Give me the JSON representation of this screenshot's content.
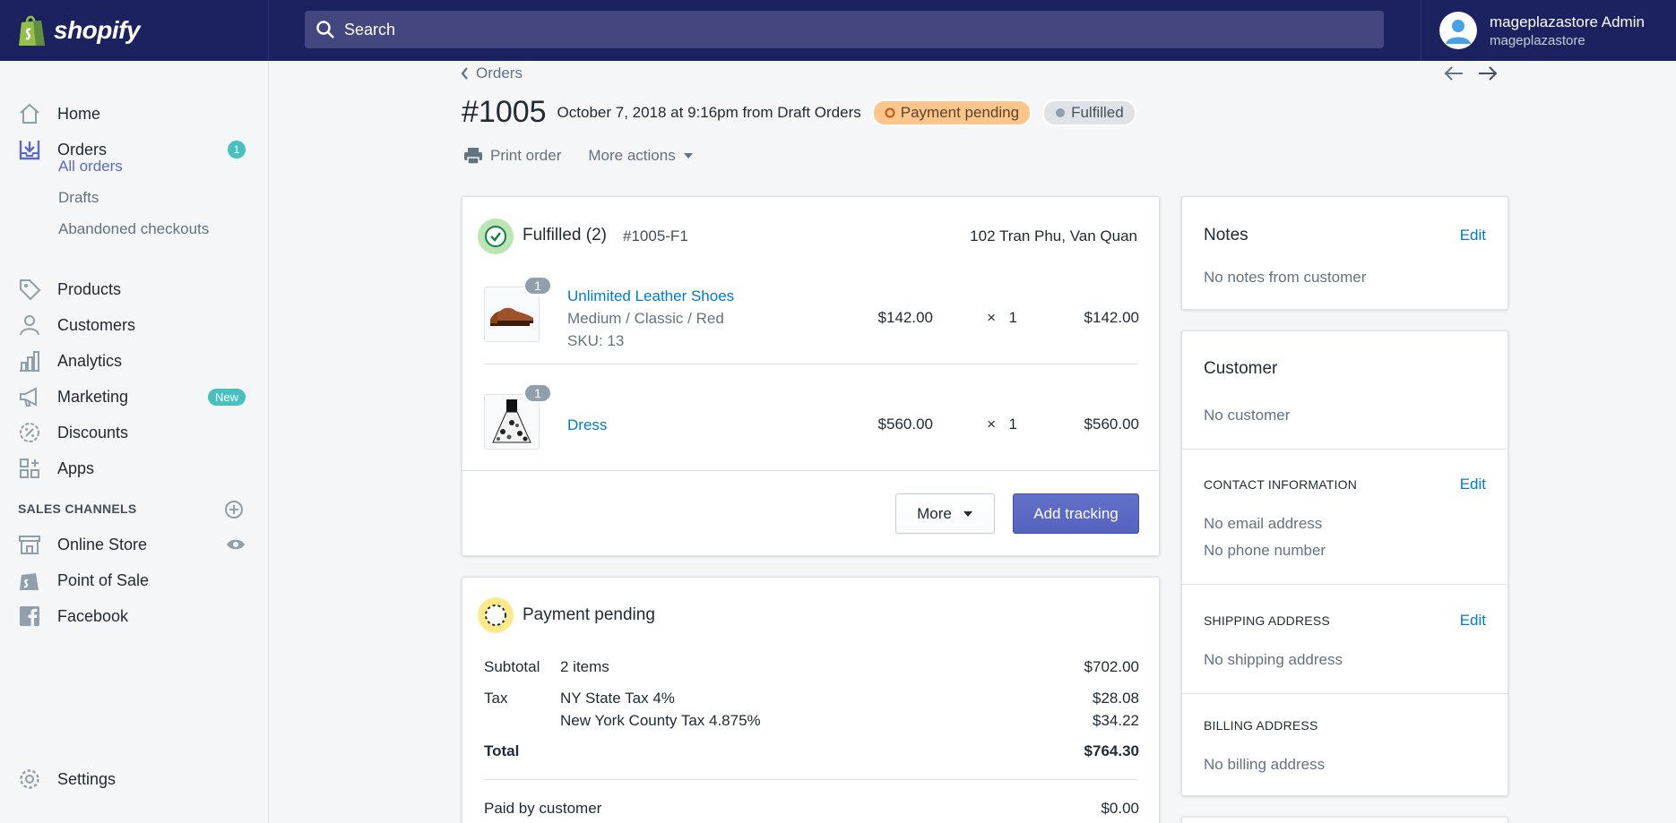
{
  "brand": {
    "name": "shopify"
  },
  "search": {
    "placeholder": "Search"
  },
  "user": {
    "name": "mageplazastore Admin",
    "store": "mageplazastore"
  },
  "sidebar": {
    "items": [
      {
        "label": "Home",
        "icon": "home-icon"
      },
      {
        "label": "Orders",
        "icon": "orders-icon",
        "badge": "1"
      },
      {
        "label": "Products",
        "icon": "tag-icon"
      },
      {
        "label": "Customers",
        "icon": "person-icon"
      },
      {
        "label": "Analytics",
        "icon": "bar-chart-icon"
      },
      {
        "label": "Marketing",
        "icon": "megaphone-icon",
        "badge": "New"
      },
      {
        "label": "Discounts",
        "icon": "discount-icon"
      },
      {
        "label": "Apps",
        "icon": "apps-icon"
      }
    ],
    "order_sub": [
      "All orders",
      "Drafts",
      "Abandoned checkouts"
    ],
    "sales_channels_title": "SALES CHANNELS",
    "channels": [
      {
        "label": "Online Store",
        "icon": "store-icon"
      },
      {
        "label": "Point of Sale",
        "icon": "shopify-bag-icon"
      },
      {
        "label": "Facebook",
        "icon": "facebook-icon"
      }
    ],
    "settings": "Settings"
  },
  "order": {
    "back_label": "Orders",
    "number": "#1005",
    "meta": "October 7, 2018 at 9:16pm from Draft Orders",
    "payment_status": "Payment pending",
    "fulfillment_status": "Fulfilled",
    "print": "Print order",
    "more_actions": "More actions"
  },
  "fulfillment": {
    "title": "Fulfilled (2)",
    "id": "#1005-F1",
    "location": "102 Tran Phu, Van Quan",
    "items": [
      {
        "name": "Unlimited Leather Shoes",
        "variant": "Medium / Classic / Red",
        "sku": "SKU: 13",
        "qty_badge": "1",
        "price": "$142.00",
        "times": "×",
        "qty": "1",
        "total": "$142.00"
      },
      {
        "name": "Dress",
        "variant": "",
        "sku": "",
        "qty_badge": "1",
        "price": "$560.00",
        "times": "×",
        "qty": "1",
        "total": "$560.00"
      }
    ],
    "more_label": "More",
    "add_tracking_label": "Add tracking"
  },
  "payment": {
    "title": "Payment pending",
    "subtotal_label": "Subtotal",
    "subtotal_desc": "2 items",
    "subtotal": "$702.00",
    "tax_label": "Tax",
    "tax_lines": [
      {
        "desc": "NY State Tax 4%",
        "amount": "$28.08"
      },
      {
        "desc": "New York County Tax 4.875%",
        "amount": "$34.22"
      }
    ],
    "total_label": "Total",
    "total": "$764.30",
    "paid_label": "Paid by customer",
    "paid": "$0.00"
  },
  "notes": {
    "title": "Notes",
    "edit": "Edit",
    "text": "No notes from customer"
  },
  "customer": {
    "title": "Customer",
    "text": "No customer",
    "contact_title": "CONTACT INFORMATION",
    "contact_edit": "Edit",
    "email": "No email address",
    "phone": "No phone number",
    "shipping_title": "SHIPPING ADDRESS",
    "shipping_edit": "Edit",
    "shipping": "No shipping address",
    "billing_title": "BILLING ADDRESS",
    "billing": "No billing address"
  },
  "colors": {
    "topbar": "#1c2260",
    "accent": "#5c6ac4",
    "link": "#007ace",
    "teal": "#47c1bf",
    "pending": "#ffc58b"
  }
}
